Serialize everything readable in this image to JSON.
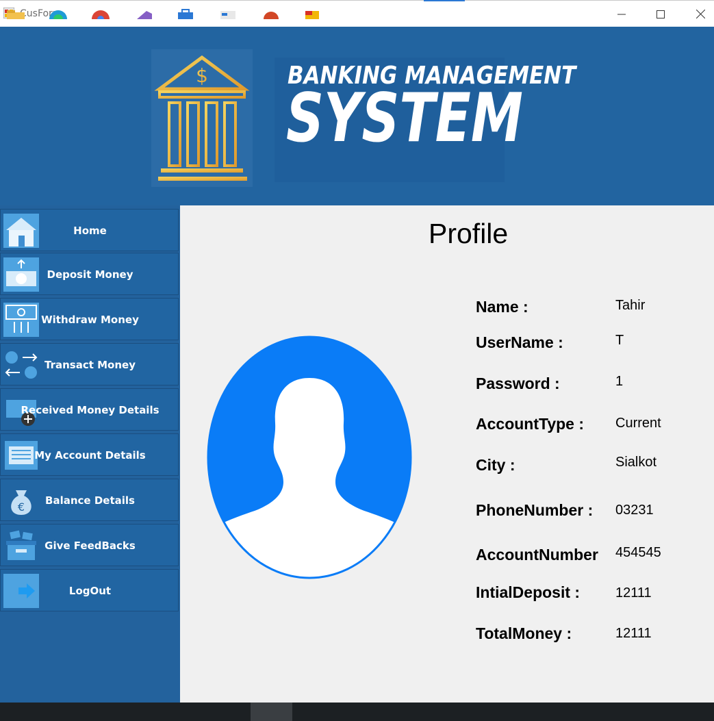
{
  "window": {
    "title": "CusForm"
  },
  "banner": {
    "title_small": "BANKING MANAGEMENT",
    "title_big": "SYSTEM"
  },
  "sidebar": {
    "items": [
      {
        "label": "Home",
        "icon": "home-icon"
      },
      {
        "label": "Deposit Money",
        "icon": "deposit-icon"
      },
      {
        "label": "Withdraw Money",
        "icon": "withdraw-icon"
      },
      {
        "label": "Transact Money",
        "icon": "transact-icon"
      },
      {
        "label": "Received Money Details",
        "icon": "received-icon"
      },
      {
        "label": "My Account Details",
        "icon": "account-details-icon"
      },
      {
        "label": "Balance Details",
        "icon": "money-bag-icon"
      },
      {
        "label": "Give FeedBacks",
        "icon": "feedback-box-icon"
      },
      {
        "label": "LogOut",
        "icon": "logout-arrow-icon"
      }
    ]
  },
  "profile": {
    "title": "Profile",
    "fields": [
      {
        "label": "Name :",
        "value": "Tahir"
      },
      {
        "label": "UserName :",
        "value": "T"
      },
      {
        "label": "Password :",
        "value": "1"
      },
      {
        "label": "AccountType :",
        "value": "Current"
      },
      {
        "label": "City :",
        "value": "Sialkot"
      },
      {
        "label": "PhoneNumber :",
        "value": "03231"
      },
      {
        "label": "AccountNumber",
        "value": "454545"
      },
      {
        "label": "IntialDeposit :",
        "value": "12111"
      },
      {
        "label": "TotalMoney :",
        "value": "12111"
      }
    ]
  },
  "colors": {
    "banner": "#2264a0",
    "sidebar": "#23629d",
    "content": "#f0f0f0",
    "avatar": "#0a7cf7",
    "gold": "#e8b83a"
  }
}
